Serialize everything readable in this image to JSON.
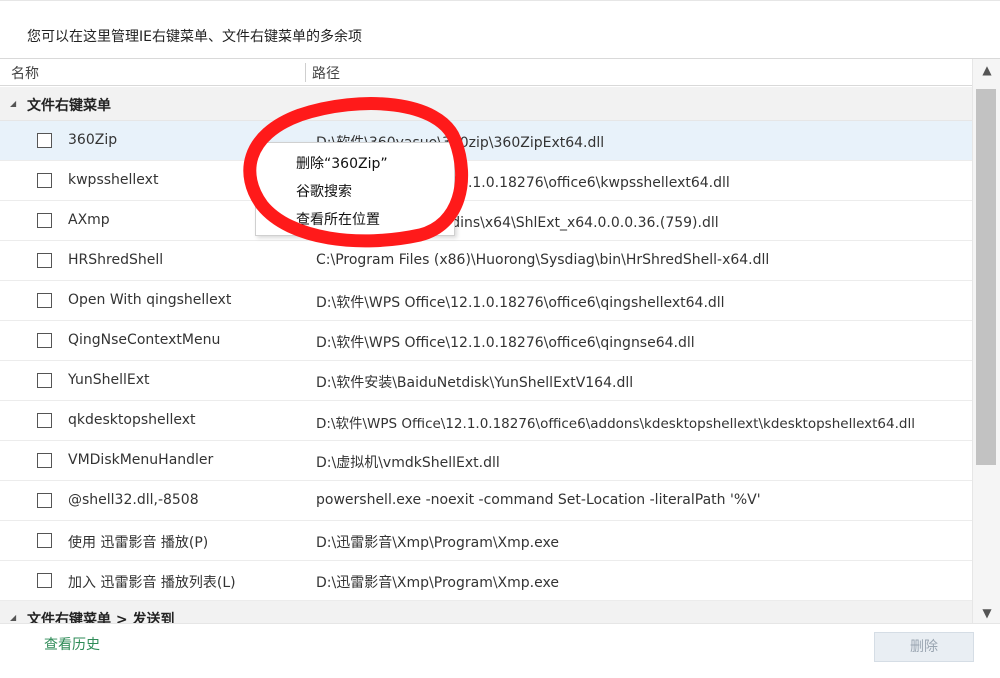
{
  "description": "您可以在这里管理IE右键菜单、文件右键菜单的多余项",
  "table": {
    "headers": {
      "name": "名称",
      "path": "路径"
    },
    "groups": [
      {
        "title": "文件右键菜单",
        "rows": [
          {
            "name": "360Zip",
            "path": "D:\\软件\\360yasuo\\360zip\\360ZipExt64.dll"
          },
          {
            "name": "kwpsshellext",
            "path": "D:\\软件\\WPS Office\\12.1.0.18276\\office6\\kwpsshellext64.dll"
          },
          {
            "name": "AXmp",
            "path": "D:\\迅雷影音\\Xmp\\addins\\x64\\ShlExt_x64.0.0.0.36.(759).dll"
          },
          {
            "name": "HRShredShell",
            "path": "C:\\Program Files (x86)\\Huorong\\Sysdiag\\bin\\HrShredShell-x64.dll"
          },
          {
            "name": "Open With qingshellext",
            "path": "D:\\软件\\WPS Office\\12.1.0.18276\\office6\\qingshellext64.dll"
          },
          {
            "name": "QingNseContextMenu",
            "path": "D:\\软件\\WPS Office\\12.1.0.18276\\office6\\qingnse64.dll"
          },
          {
            "name": "YunShellExt",
            "path": "D:\\软件安装\\BaiduNetdisk\\YunShellExtV164.dll"
          },
          {
            "name": "qkdesktopshellext",
            "path": "D:\\软件\\WPS Office\\12.1.0.18276\\office6\\addons\\kdesktopshellext\\kdesktopshellext64.dll"
          },
          {
            "name": "VMDiskMenuHandler",
            "path": "D:\\虚拟机\\vmdkShellExt.dll"
          },
          {
            "name": "@shell32.dll,-8508",
            "path": "powershell.exe -noexit -command Set-Location -literalPath '%V'"
          },
          {
            "name": "使用 迅雷影音 播放(P)",
            "path": "D:\\迅雷影音\\Xmp\\Program\\Xmp.exe"
          },
          {
            "name": "加入 迅雷影音 播放列表(L)",
            "path": "D:\\迅雷影音\\Xmp\\Program\\Xmp.exe"
          }
        ]
      },
      {
        "title": "文件右键菜单 > 发送到",
        "rows": []
      }
    ]
  },
  "context_menu": {
    "items": [
      "删除“360Zip”",
      "谷歌搜索",
      "查看所在位置"
    ]
  },
  "footer": {
    "history_label": "查看历史",
    "delete_label": "删除"
  },
  "scrollbar": {
    "up_icon": "▲",
    "down_icon": "▼"
  },
  "colors": {
    "hover_row": "#e8f2fa",
    "history_link": "#2e8b57",
    "annotation": "#ff0000",
    "disabled_button_bg": "#e9eef3"
  }
}
